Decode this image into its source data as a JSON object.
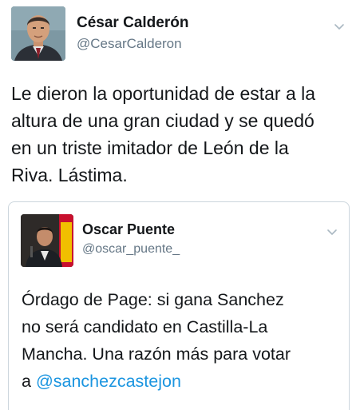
{
  "tweet": {
    "author_name": "César Calderón",
    "author_handle": "@CesarCalderon",
    "text_lines": [
      "Le dieron la oportunidad de estar a la",
      "altura de una gran ciudad y se quedó",
      "en un triste imitador de León de la",
      "Riva. Lástima."
    ]
  },
  "quoted_tweet": {
    "author_name": "Oscar Puente",
    "author_handle": "@oscar_puente_",
    "text_lines": [
      "Órdago de Page: si gana Sanchez",
      "no será candidato en Castilla-La",
      "Mancha. Una razón más para votar"
    ],
    "last_line_prefix": "a ",
    "mention": "@sanchezcastejon"
  },
  "icons": {
    "chevron": "chevron-down-icon",
    "avatar": "avatar",
    "quoted_avatar": "avatar"
  },
  "colors": {
    "text": "#14171a",
    "secondary": "#657786",
    "link": "#1b95e0",
    "border": "#ccd6dd"
  }
}
